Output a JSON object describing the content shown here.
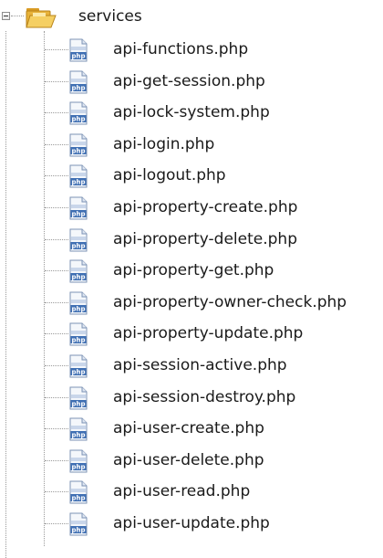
{
  "tree": {
    "root": {
      "label": "services",
      "icon": "folder-icon",
      "expanded": true
    },
    "items": [
      {
        "label": "api-functions.php",
        "icon": "php-file-icon"
      },
      {
        "label": "api-get-session.php",
        "icon": "php-file-icon"
      },
      {
        "label": "api-lock-system.php",
        "icon": "php-file-icon"
      },
      {
        "label": "api-login.php",
        "icon": "php-file-icon"
      },
      {
        "label": "api-logout.php",
        "icon": "php-file-icon"
      },
      {
        "label": "api-property-create.php",
        "icon": "php-file-icon"
      },
      {
        "label": "api-property-delete.php",
        "icon": "php-file-icon"
      },
      {
        "label": "api-property-get.php",
        "icon": "php-file-icon"
      },
      {
        "label": "api-property-owner-check.php",
        "icon": "php-file-icon"
      },
      {
        "label": "api-property-update.php",
        "icon": "php-file-icon"
      },
      {
        "label": "api-session-active.php",
        "icon": "php-file-icon"
      },
      {
        "label": "api-session-destroy.php",
        "icon": "php-file-icon"
      },
      {
        "label": "api-user-create.php",
        "icon": "php-file-icon"
      },
      {
        "label": "api-user-delete.php",
        "icon": "php-file-icon"
      },
      {
        "label": "api-user-read.php",
        "icon": "php-file-icon"
      },
      {
        "label": "api-user-update.php",
        "icon": "php-file-icon"
      }
    ],
    "icon_text": "php",
    "colors": {
      "folder": "#e8b33a",
      "php_icon_blue": "#3f6fb3",
      "guide_lines": "#9a9a9a"
    }
  }
}
